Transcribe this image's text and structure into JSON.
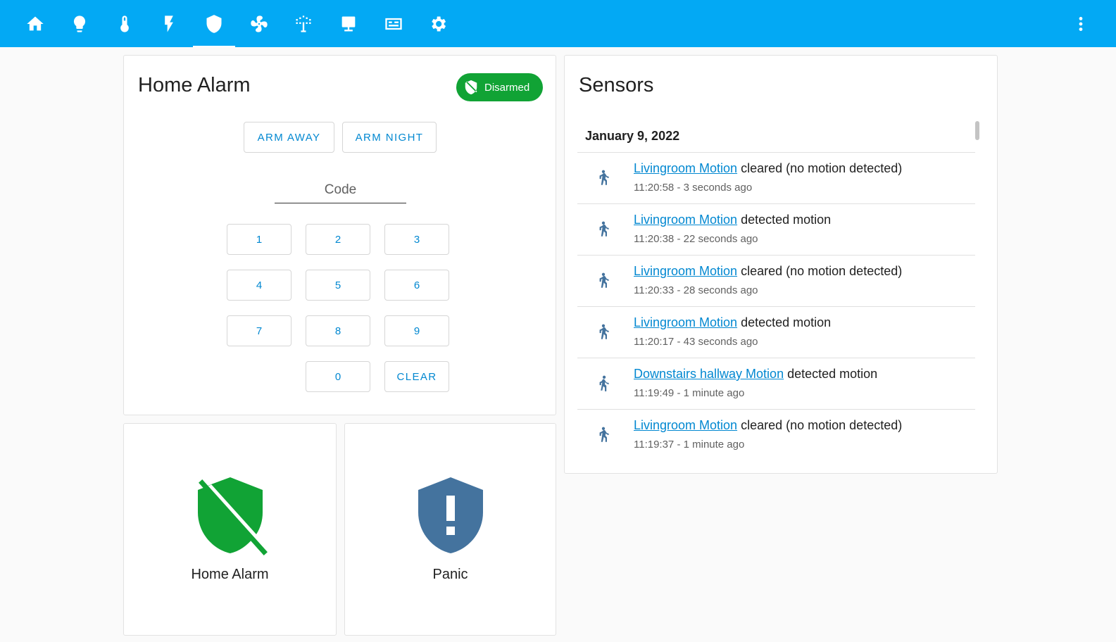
{
  "nav": {
    "tabs": [
      {
        "name": "home-icon",
        "active": false
      },
      {
        "name": "lightbulb-icon",
        "active": false
      },
      {
        "name": "thermometer-icon",
        "active": false
      },
      {
        "name": "flash-icon",
        "active": false
      },
      {
        "name": "shield-icon",
        "active": true
      },
      {
        "name": "fan-icon",
        "active": false
      },
      {
        "name": "sprinkler-icon",
        "active": false
      },
      {
        "name": "monitor-icon",
        "active": false
      },
      {
        "name": "server-icon",
        "active": false
      },
      {
        "name": "gear-icon",
        "active": false
      }
    ],
    "menu_icon": "dots-vertical-icon"
  },
  "alarm_panel": {
    "title": "Home Alarm",
    "state": "Disarmed",
    "state_color": "#11a335",
    "arm_away": "ARM AWAY",
    "arm_night": "ARM NIGHT",
    "code_placeholder": "Code",
    "code_value": "",
    "keys": [
      "1",
      "2",
      "3",
      "4",
      "5",
      "6",
      "7",
      "8",
      "9",
      "0"
    ],
    "clear": "CLEAR"
  },
  "sensors": {
    "title": "Sensors",
    "date": "January 9, 2022",
    "entries": [
      {
        "entity": "Livingroom Motion",
        "message": "cleared (no motion detected)",
        "time": "11:20:58 - 3 seconds ago"
      },
      {
        "entity": "Livingroom Motion",
        "message": "detected motion",
        "time": "11:20:38 - 22 seconds ago"
      },
      {
        "entity": "Livingroom Motion",
        "message": "cleared (no motion detected)",
        "time": "11:20:33 - 28 seconds ago"
      },
      {
        "entity": "Livingroom Motion",
        "message": "detected motion",
        "time": "11:20:17 - 43 seconds ago"
      },
      {
        "entity": "Downstairs hallway Motion",
        "message": "detected motion",
        "time": "11:19:49 - 1 minute ago"
      },
      {
        "entity": "Livingroom Motion",
        "message": "cleared (no motion detected)",
        "time": "11:19:37 - 1 minute ago"
      }
    ]
  },
  "tiles": {
    "alarm": {
      "label": "Home Alarm",
      "icon": "shield-off-icon",
      "color": "#11a335"
    },
    "panic": {
      "label": "Panic",
      "icon": "shield-alert-icon",
      "color": "#44739e"
    }
  }
}
